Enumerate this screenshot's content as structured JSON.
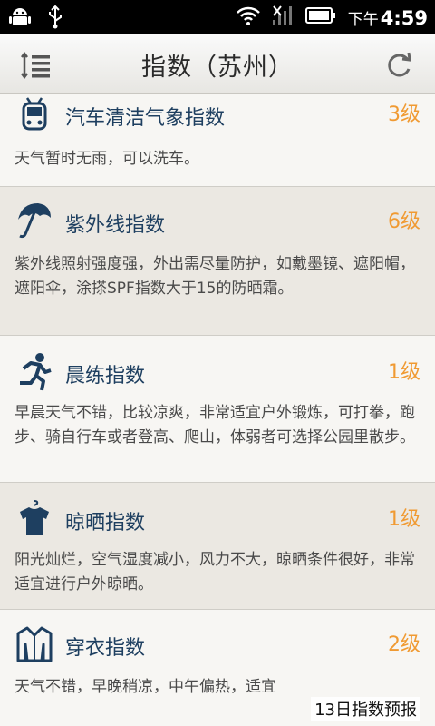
{
  "status_bar": {
    "time_ampm": "下午",
    "time": "4:59",
    "icons": [
      "android-icon",
      "usb-icon",
      "wifi-icon",
      "signal-icon",
      "battery-icon"
    ]
  },
  "header": {
    "title": "指数（苏州）",
    "menu_icon": "list-menu-icon",
    "refresh_icon": "refresh-icon"
  },
  "indices": [
    {
      "name": "汽车清洁气象指数",
      "level": "3级",
      "description": "天气暂时无雨，可以洗车。",
      "icon": "car-wash-icon"
    },
    {
      "name": "紫外线指数",
      "level": "6级",
      "description": "紫外线照射强度强，外出需尽量防护，如戴墨镜、遮阳帽，遮阳伞，涂搽SPF指数大于15的防晒霜。",
      "icon": "umbrella-icon"
    },
    {
      "name": "晨练指数",
      "level": "1级",
      "description": "早晨天气不错，比较凉爽，非常适宜户外锻炼，可打拳，跑步、骑自行车或者登高、爬山，体弱者可选择公园里散步。",
      "icon": "running-icon"
    },
    {
      "name": "晾晒指数",
      "level": "1级",
      "description": "阳光灿烂，空气湿度减小，风力不大，晾晒条件很好，非常适宜进行户外晾晒。",
      "icon": "tshirt-hanger-icon"
    },
    {
      "name": "穿衣指数",
      "level": "2级",
      "description": "天气不错，早晚稍凉，中午偏热，适宜",
      "icon": "jacket-icon"
    }
  ],
  "footer": {
    "forecast_link": "13日指数预报"
  },
  "colors": {
    "accent_level": "#f09a32",
    "title_text": "#1e3f60"
  }
}
